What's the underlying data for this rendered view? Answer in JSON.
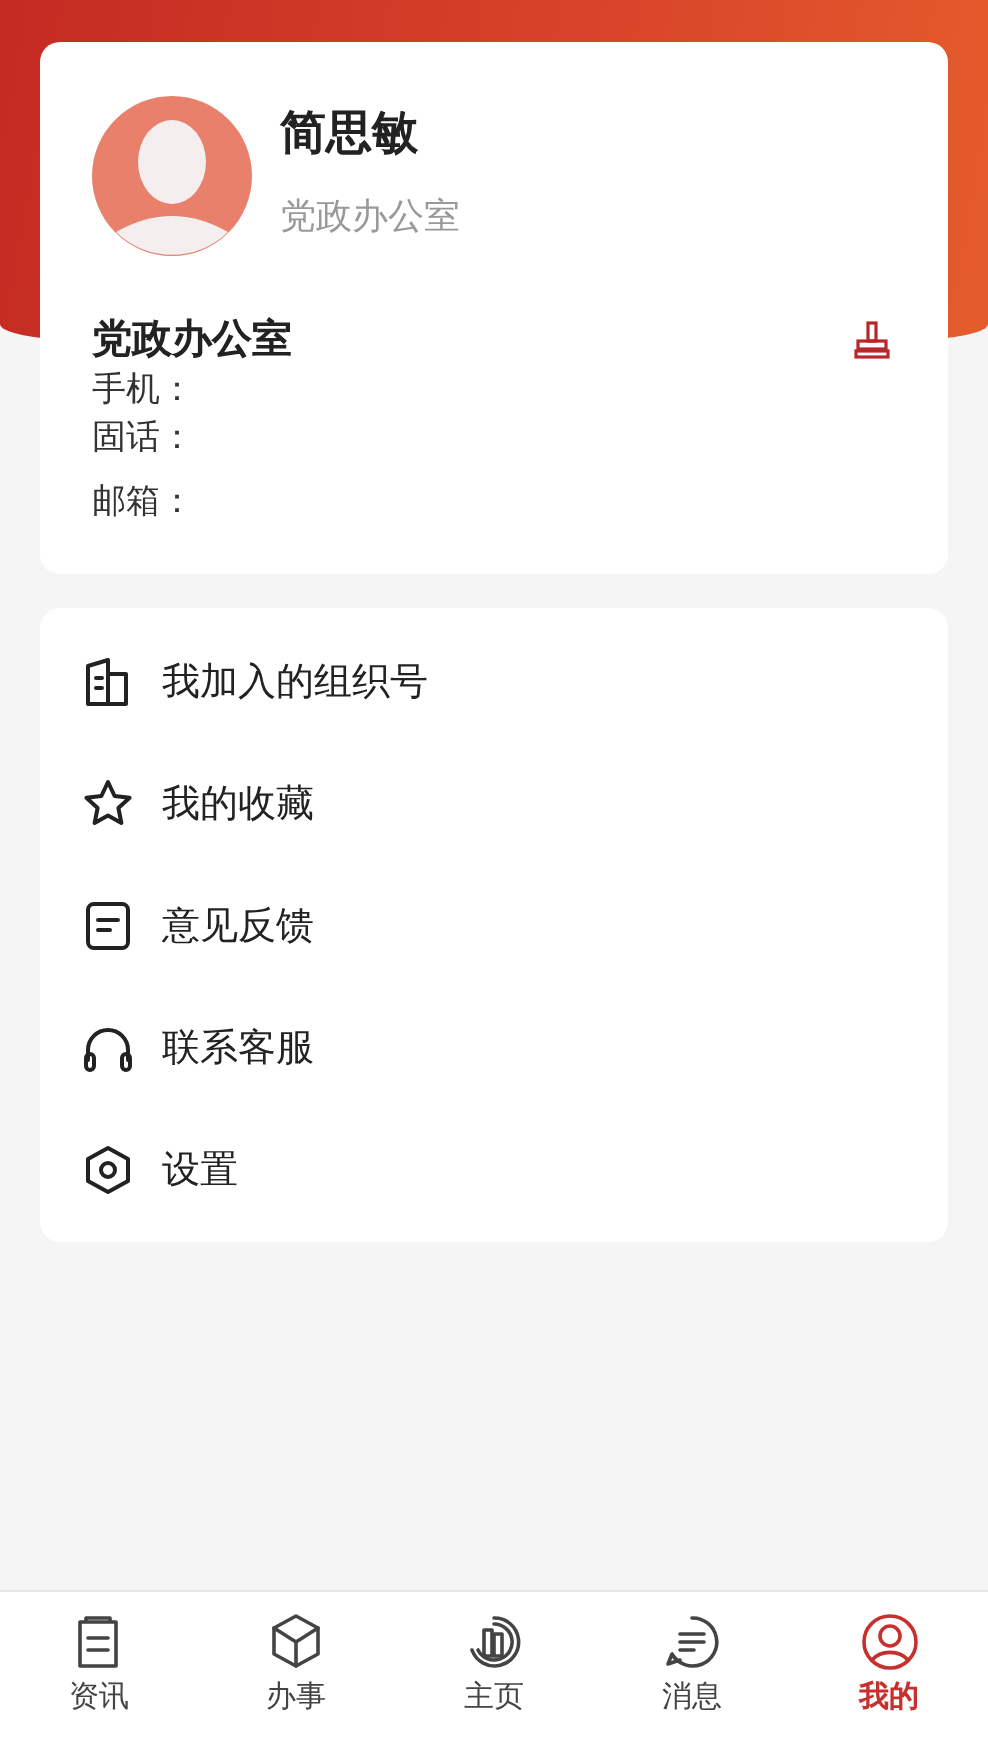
{
  "profile": {
    "name": "简思敏",
    "department": "党政办公室"
  },
  "contact": {
    "org": "党政办公室",
    "fields": [
      {
        "label": "手机："
      },
      {
        "label": "固话："
      },
      {
        "label": "邮箱："
      }
    ]
  },
  "menu": [
    {
      "kind": "building",
      "label": "我加入的组织号"
    },
    {
      "kind": "star",
      "label": "我的收藏"
    },
    {
      "kind": "note",
      "label": "意见反馈"
    },
    {
      "kind": "headset",
      "label": "联系客服"
    },
    {
      "kind": "hexagon",
      "label": "设置"
    }
  ],
  "tabs": [
    {
      "kind": "clipboard",
      "label": "资讯",
      "selected": false
    },
    {
      "kind": "cube",
      "label": "办事",
      "selected": false
    },
    {
      "kind": "home",
      "label": "主页",
      "selected": false
    },
    {
      "kind": "chat",
      "label": "消息",
      "selected": false
    },
    {
      "kind": "person",
      "label": "我的",
      "selected": true
    }
  ]
}
